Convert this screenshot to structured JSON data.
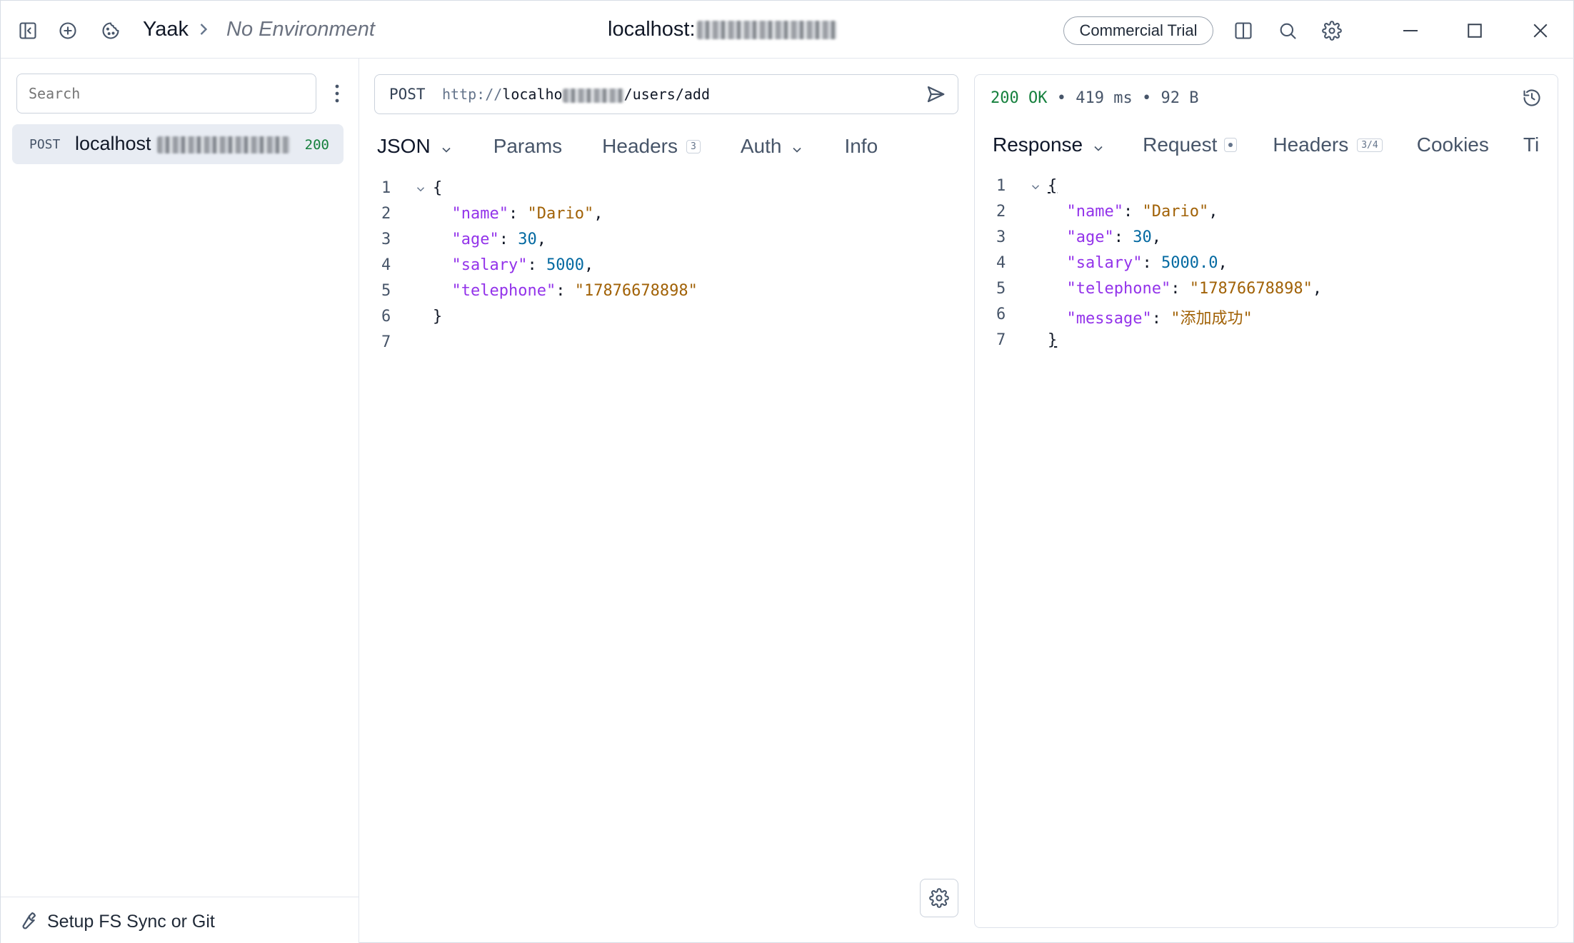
{
  "titlebar": {
    "app_name": "Yaak",
    "environment": "No Environment",
    "url_prefix": "localhost:",
    "trial_label": "Commercial Trial"
  },
  "sidebar": {
    "search_placeholder": "Search",
    "items": [
      {
        "method": "POST",
        "name": "localhost",
        "status": "200"
      }
    ],
    "footer_label": "Setup FS Sync or Git"
  },
  "request": {
    "method": "POST",
    "url_scheme": "http://",
    "url_host": "localho",
    "url_path": "/users/add",
    "tabs": [
      {
        "label": "JSON",
        "dropdown": true
      },
      {
        "label": "Params"
      },
      {
        "label": "Headers",
        "badge": "3"
      },
      {
        "label": "Auth",
        "dropdown": true
      },
      {
        "label": "Info"
      }
    ],
    "body_lines": [
      {
        "n": "1",
        "fold": true,
        "tokens": [
          [
            "p",
            "{"
          ]
        ]
      },
      {
        "n": "2",
        "tokens": [
          [
            "p",
            "  "
          ],
          [
            "k",
            "\"name\""
          ],
          [
            "p",
            ": "
          ],
          [
            "s",
            "\"Dario\""
          ],
          [
            "p",
            ","
          ]
        ]
      },
      {
        "n": "3",
        "tokens": [
          [
            "p",
            "  "
          ],
          [
            "k",
            "\"age\""
          ],
          [
            "p",
            ": "
          ],
          [
            "n",
            "30"
          ],
          [
            "p",
            ","
          ]
        ]
      },
      {
        "n": "4",
        "tokens": [
          [
            "p",
            "  "
          ],
          [
            "k",
            "\"salary\""
          ],
          [
            "p",
            ": "
          ],
          [
            "n",
            "5000"
          ],
          [
            "p",
            ","
          ]
        ]
      },
      {
        "n": "5",
        "tokens": [
          [
            "p",
            "  "
          ],
          [
            "k",
            "\"telephone\""
          ],
          [
            "p",
            ": "
          ],
          [
            "s",
            "\"17876678898\""
          ]
        ]
      },
      {
        "n": "6",
        "tokens": [
          [
            "p",
            "}"
          ]
        ]
      },
      {
        "n": "7",
        "tokens": []
      }
    ]
  },
  "response": {
    "status_code": "200 OK",
    "time": "419 ms",
    "size": "92 B",
    "separator": "•",
    "tabs": [
      {
        "label": "Response",
        "dropdown": true
      },
      {
        "label": "Request",
        "dot": true
      },
      {
        "label": "Headers",
        "badge": "3/4"
      },
      {
        "label": "Cookies"
      },
      {
        "label": "Ti"
      }
    ],
    "body_lines": [
      {
        "n": "1",
        "fold": true,
        "tokens": [
          [
            "p",
            "{"
          ]
        ]
      },
      {
        "n": "2",
        "tokens": [
          [
            "p",
            "  "
          ],
          [
            "k",
            "\"name\""
          ],
          [
            "p",
            ": "
          ],
          [
            "s",
            "\"Dario\""
          ],
          [
            "p",
            ","
          ]
        ]
      },
      {
        "n": "3",
        "tokens": [
          [
            "p",
            "  "
          ],
          [
            "k",
            "\"age\""
          ],
          [
            "p",
            ": "
          ],
          [
            "n",
            "30"
          ],
          [
            "p",
            ","
          ]
        ]
      },
      {
        "n": "4",
        "tokens": [
          [
            "p",
            "  "
          ],
          [
            "k",
            "\"salary\""
          ],
          [
            "p",
            ": "
          ],
          [
            "n",
            "5000.0"
          ],
          [
            "p",
            ","
          ]
        ]
      },
      {
        "n": "5",
        "tokens": [
          [
            "p",
            "  "
          ],
          [
            "k",
            "\"telephone\""
          ],
          [
            "p",
            ": "
          ],
          [
            "s",
            "\"17876678898\""
          ],
          [
            "p",
            ","
          ]
        ]
      },
      {
        "n": "6",
        "tokens": [
          [
            "p",
            "  "
          ],
          [
            "k",
            "\"message\""
          ],
          [
            "p",
            ": "
          ],
          [
            "s",
            "\"添加成功\""
          ]
        ]
      },
      {
        "n": "7",
        "tokens": [
          [
            "p",
            "}"
          ]
        ]
      }
    ]
  },
  "colors": {
    "status_ok": "#15803d",
    "json_key": "#9333ea",
    "json_string": "#a16207",
    "json_number": "#0369a1"
  }
}
